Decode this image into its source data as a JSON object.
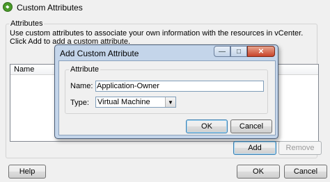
{
  "window": {
    "title": "Custom Attributes",
    "icon": "vsphere-app-icon"
  },
  "attributes_group": {
    "legend": "Attributes",
    "description_line1": "Use custom attributes to associate your own information with the resources in vCenter.",
    "description_line2": "Click Add to add a custom attribute.",
    "table": {
      "columns": [
        "Name"
      ],
      "rows": []
    },
    "add_label": "Add",
    "remove_label": "Remove"
  },
  "footer": {
    "help_label": "Help",
    "ok_label": "OK",
    "cancel_label": "Cancel"
  },
  "dialog": {
    "title": "Add Custom Attribute",
    "group_legend": "Attribute",
    "name_label": "Name:",
    "name_value": "Application-Owner",
    "type_label": "Type:",
    "type_value": "Virtual Machine",
    "ok_label": "OK",
    "cancel_label": "Cancel"
  },
  "colors": {
    "dialog_frame": "#c4d5ea",
    "close_button": "#c8432a"
  }
}
